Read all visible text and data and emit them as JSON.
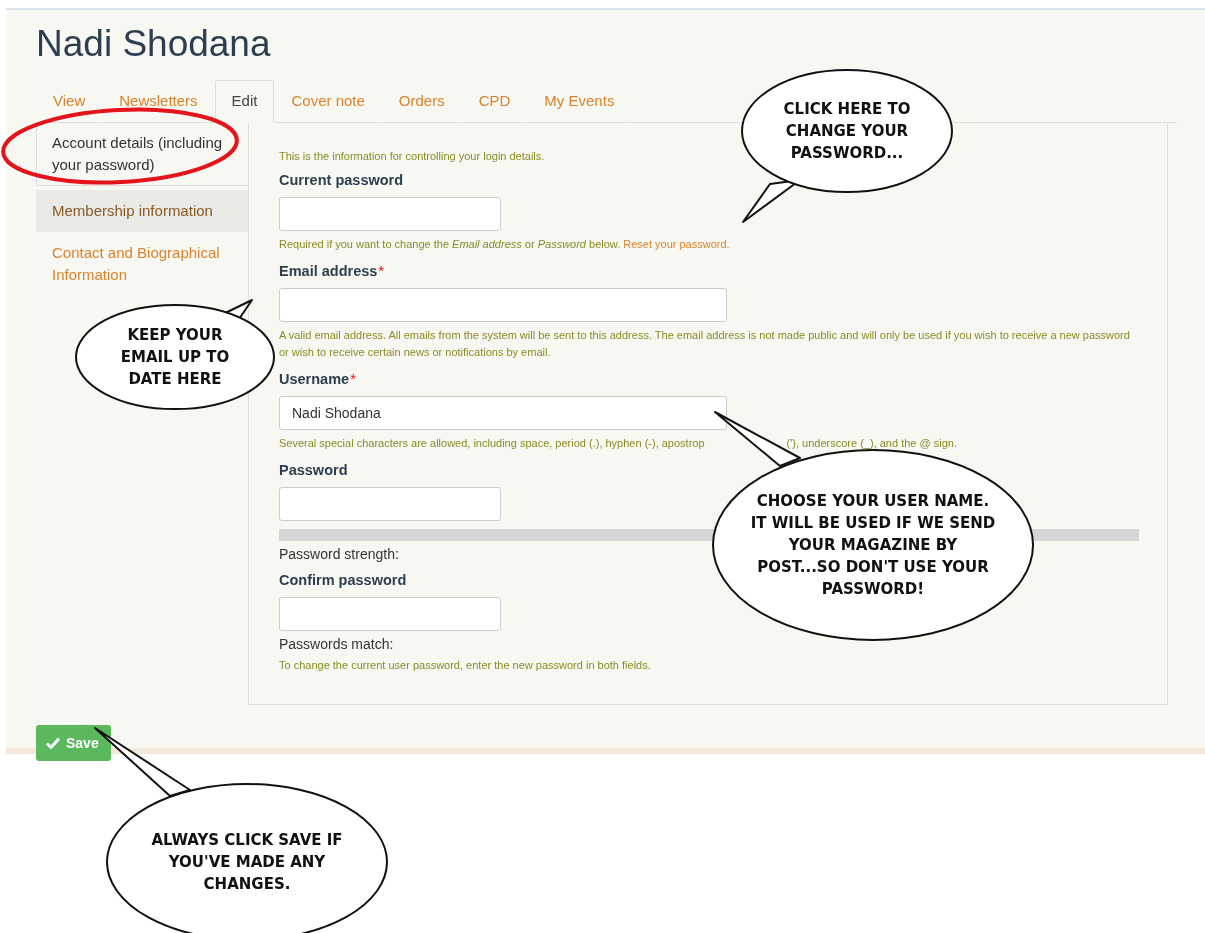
{
  "title": "Nadi Shodana",
  "tabs": [
    {
      "label": "View",
      "selected": false
    },
    {
      "label": "Newsletters",
      "selected": false
    },
    {
      "label": "Edit",
      "selected": true
    },
    {
      "label": "Cover note",
      "selected": false
    },
    {
      "label": "Orders",
      "selected": false
    },
    {
      "label": "CPD",
      "selected": false
    },
    {
      "label": "My Events",
      "selected": false
    }
  ],
  "sidebar": {
    "items": [
      {
        "label": "Account details (including your password)",
        "selected": true,
        "highlighted": false
      },
      {
        "label": "Membership information",
        "selected": false,
        "highlighted": true
      },
      {
        "label": "Contact and Biographical Information",
        "selected": false,
        "highlighted": false
      }
    ]
  },
  "form": {
    "intro": "This is the information for controlling your login details.",
    "fields": [
      {
        "kind": "password",
        "label": "Current password",
        "description": [
          "Required if you want to change the *Email address* or *Password* below."
        ],
        "link": "Reset your password."
      },
      {
        "kind": "text",
        "label": "Email address",
        "required_mark": "*",
        "description": [
          "A valid email address. All emails from the system will be sent to this address. The email address is not made public and will only be used if you wish to receive a new password or wish to receive certain news or notifications by email."
        ]
      },
      {
        "kind": "text",
        "label": "Username",
        "required_mark": "*",
        "value": "Nadi Shodana",
        "description": [
          "Several special characters are allowed, including space, period (.), hyphen (-), apostrop",
          "('), underscore (_), and the @ sign."
        ]
      },
      {
        "kind": "password",
        "label": "Password",
        "meter": true,
        "status": "Password strength:"
      },
      {
        "kind": "password",
        "label": "Confirm password",
        "status": "Passwords match:",
        "description": [
          "To change the current user password, enter the new password in both fields."
        ]
      }
    ]
  },
  "save_button": "Save",
  "annotations": [
    {
      "kind": "circle"
    },
    {
      "kind": "bubble",
      "text": "CLICK HERE TO CHANGE YOUR PASSWORD..."
    },
    {
      "kind": "bubble",
      "text": "KEEP YOUR EMAIL UP TO DATE HERE"
    },
    {
      "kind": "bubble",
      "text": "CHOOSE YOUR USER NAME.\nIT WILL BE USED IF WE SEND YOUR MAGAZINE BY POST...SO DON'T USE YOUR PASSWORD!"
    },
    {
      "kind": "bubble",
      "text": "ALWAYS CLICK SAVE IF YOU'VE MADE ANY CHANGES."
    }
  ]
}
